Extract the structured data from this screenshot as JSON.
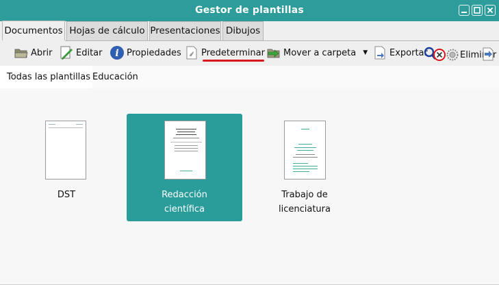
{
  "window": {
    "title": "Gestor de plantillas",
    "titlebar_color": "#2e9c9a"
  },
  "tabs": [
    {
      "label": "Documentos",
      "active": true
    },
    {
      "label": "Hojas de cálculo",
      "active": false
    },
    {
      "label": "Presentaciones",
      "active": false
    },
    {
      "label": "Dibujos",
      "active": false
    }
  ],
  "toolbar": {
    "open": "Abrir",
    "edit": "Editar",
    "properties": "Propiedades",
    "set_default": "Predeterminar",
    "move_to_folder": "Mover a carpeta",
    "export": "Exportar",
    "delete": "Eliminar"
  },
  "breadcrumb": {
    "all": "Todas las plantillas",
    "current": "Educación"
  },
  "templates": [
    {
      "name": "DST",
      "selected": false
    },
    {
      "name": "Redacción científica",
      "selected": true
    },
    {
      "name": "Trabajo de licenciatura",
      "selected": false
    }
  ],
  "accent_color": "#2a9d9b",
  "highlight_color": "#d9171b"
}
